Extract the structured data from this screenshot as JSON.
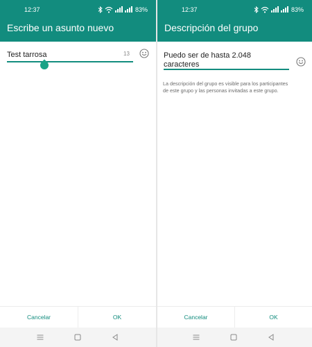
{
  "left": {
    "status": {
      "time": "12:37",
      "battery": "83%"
    },
    "title": "Escribe un asunto nuevo",
    "input_value": "Test tarrosa",
    "counter": "13",
    "buttons": {
      "cancel": "Cancelar",
      "ok": "OK"
    }
  },
  "right": {
    "status": {
      "time": "12:37",
      "battery": "83%"
    },
    "title": "Descripción del grupo",
    "input_line1": "Puedo ser de hasta 2.048",
    "input_line2": "caracteres",
    "helper_line1": "La descripción del grupo es visible para los participantes",
    "helper_line2": "de este grupo y las personas invitadas a este grupo.",
    "buttons": {
      "cancel": "Cancelar",
      "ok": "OK"
    }
  },
  "colors": {
    "accent": "#128c7e",
    "handle": "#1aa386"
  },
  "icons": [
    "bluetooth-icon",
    "wifi-icon",
    "signal-icon",
    "emoji-icon",
    "menu-nav-icon",
    "home-nav-icon",
    "back-nav-icon"
  ]
}
